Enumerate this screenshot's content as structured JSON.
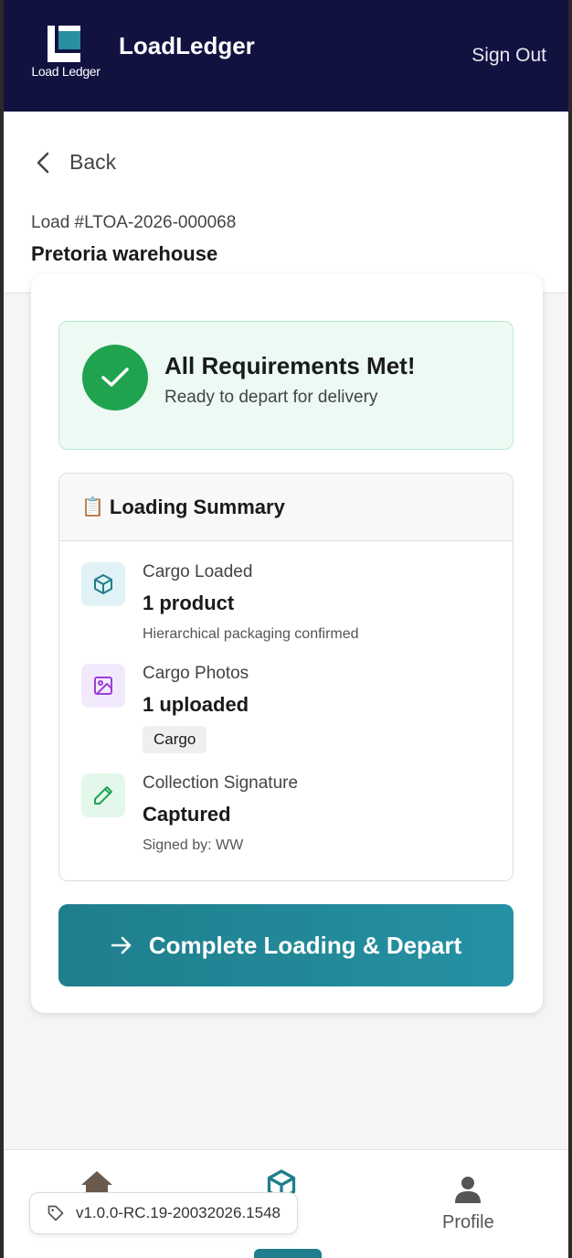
{
  "app": {
    "brand": "LoadLedger",
    "logo_caption": "Load Ledger",
    "sign_out_label": "Sign Out"
  },
  "nav": {
    "back_label": "Back"
  },
  "load": {
    "id": "Load #LTOA-2026-000068",
    "location": "Pretoria warehouse"
  },
  "status": {
    "title": "All Requirements Met!",
    "subtitle": "Ready to depart for delivery"
  },
  "summary": {
    "emoji": "📋",
    "title": "Loading Summary",
    "items": [
      {
        "label": "Cargo Loaded",
        "value": "1 product",
        "note": "Hierarchical packaging confirmed",
        "icon": "box-icon"
      },
      {
        "label": "Cargo Photos",
        "value": "1 uploaded",
        "tag": "Cargo",
        "icon": "image-icon"
      },
      {
        "label": "Collection Signature",
        "value": "Captured",
        "note": "Signed by: WW",
        "icon": "pencil-icon"
      }
    ]
  },
  "action": {
    "depart_label": "Complete Loading & Depart"
  },
  "bottom_nav": {
    "profile_label": "Profile"
  },
  "version": "v1.0.0-RC.19-20032026.1548",
  "colors": {
    "header_bg": "#121241",
    "accent": "#1f7e8c",
    "success": "#1fa34f"
  }
}
